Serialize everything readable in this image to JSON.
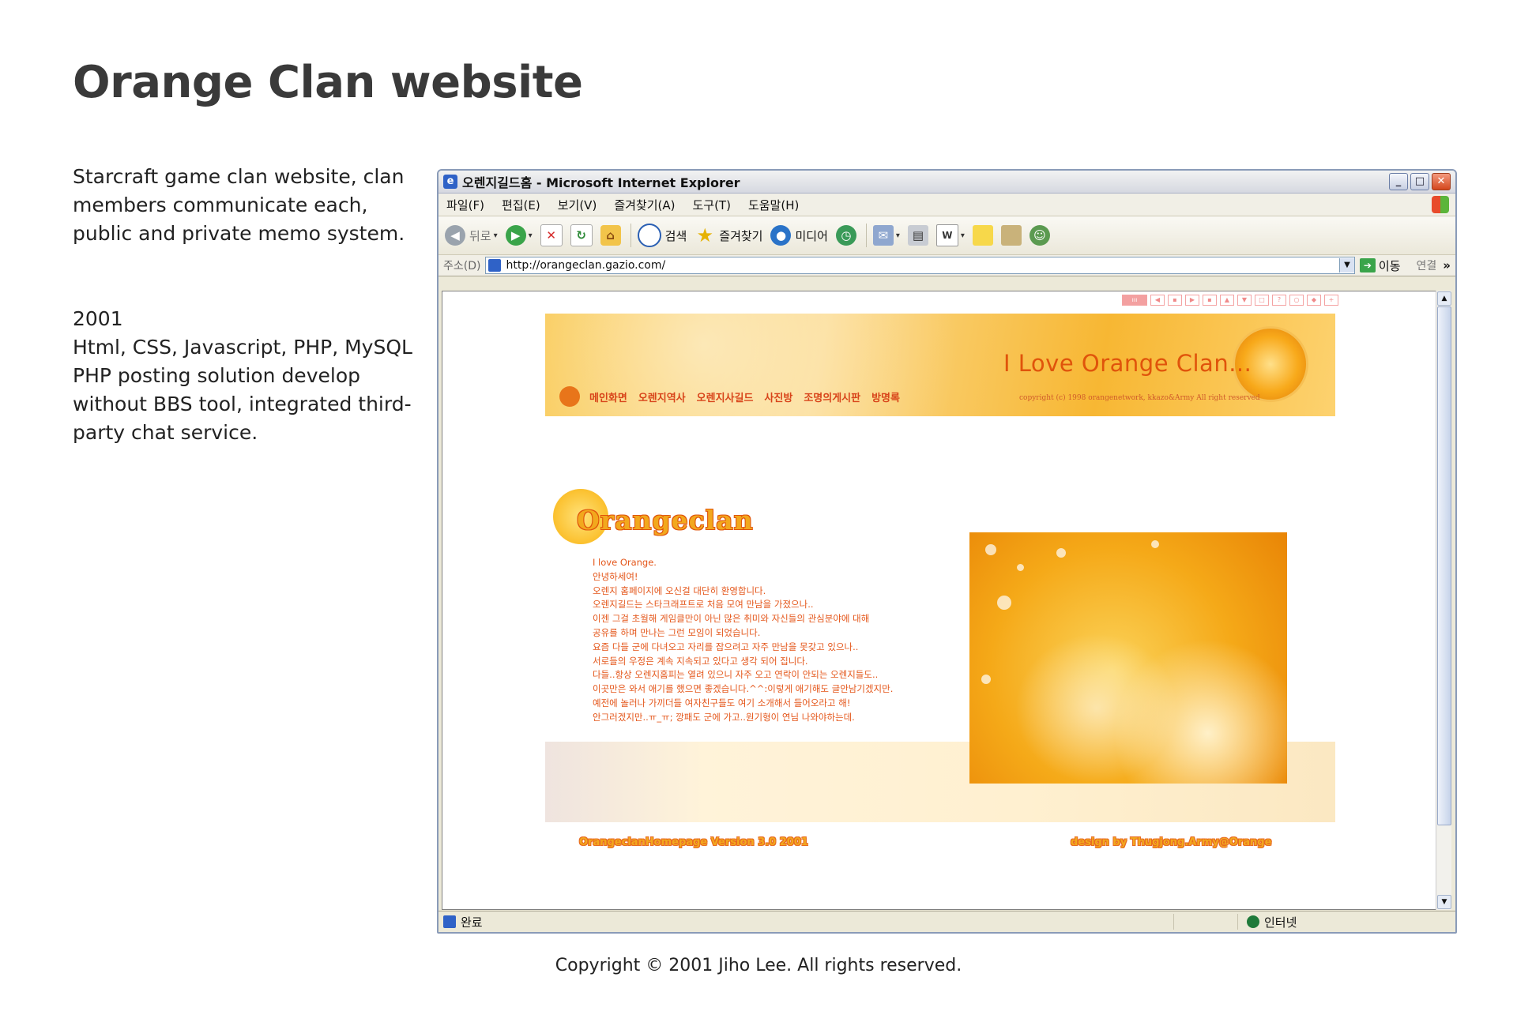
{
  "portfolio": {
    "title": "Orange Clan website",
    "description": "Starcraft game clan website, clan members communicate each, public and private memo system.",
    "year": "2001",
    "tech": "Html, CSS, Javascript, PHP, MySQL",
    "detail": "PHP posting solution develop without BBS tool, integrated third-party chat service.",
    "copyright": "Copyright © 2001 Jiho Lee. All rights reserved."
  },
  "browser": {
    "window_title": "오렌지길드홈 - Microsoft Internet Explorer",
    "menu": [
      "파일(F)",
      "편집(E)",
      "보기(V)",
      "즐겨찾기(A)",
      "도구(T)",
      "도움말(H)"
    ],
    "toolbar": {
      "back": "뒤로",
      "search": "검색",
      "favorites": "즐겨찾기",
      "media": "미디어"
    },
    "address_label": "주소(D)",
    "url": "http://orangeclan.gazio.com/",
    "go_label": "이동",
    "links_label": "연결",
    "status_text": "완료",
    "zone_text": "인터넷"
  },
  "site": {
    "slogan": "I Love Orange Clan...",
    "nav_items": [
      "메인화면",
      "오렌지역사",
      "오렌지사길드",
      "사진방",
      "조명의게시판",
      "방명록"
    ],
    "banner_copyright": "copyright (c) 1998 orangenetwork, kkazo&Army  All right reserved",
    "logo_text": "Orangeclan",
    "intro_lines": [
      "I love Orange.",
      "안녕하세여!",
      "오렌지 홈페이지에 오신걸 대단히 환영합니다.",
      "오렌지길드는 스타크래프트로 처음 모여 만남을 가졌으나..",
      "이젠 그걸 초월해 게임클만이 아닌 많은 취미와 자신들의 관심분야에 대해",
      "공유를 하며 만나는 그런 모임이 되었습니다.",
      "요즘 다들 군에 다녀오고 자리를 잡으려고 자주 만남을 못갖고 있으나..",
      "서로들의 우정은 계속 지속되고 있다고 생각 되어 집니다.",
      "다들..항상 오렌지홈피는 열려 있으니 자주 오고 연락이 안되는 오렌지들도..",
      "이곳만은 와서 애기를 했으면 좋겠습니다.^^:이렇게 애기해도 글안남기겠지만.",
      "예전에 놀러나 가끼더들 여자친구들도 여기 소개해서 들어오라고 해!",
      "안그러겠지만..ㅠ_ㅠ; 깡패도 군에 가고..원기형이 연님 나와야하는데."
    ],
    "footer_left": "OrangeclanHomepage Version 3.0 2001",
    "footer_right": "design by Thugjong.Army@Orange"
  },
  "colors": {
    "accent_orange": "#e0540b",
    "logo_yellow": "#f2a81d",
    "xp_titlebar": "#d6d8e0"
  },
  "icons": [
    "ie-icon",
    "back-icon",
    "forward-icon",
    "stop-icon",
    "refresh-icon",
    "home-icon",
    "search-icon",
    "favorites-star-icon",
    "media-icon",
    "history-icon",
    "mail-icon",
    "print-icon",
    "edit-icon",
    "messenger-icon",
    "go-arrow-icon",
    "globe-icon",
    "windows-logo-icon"
  ]
}
